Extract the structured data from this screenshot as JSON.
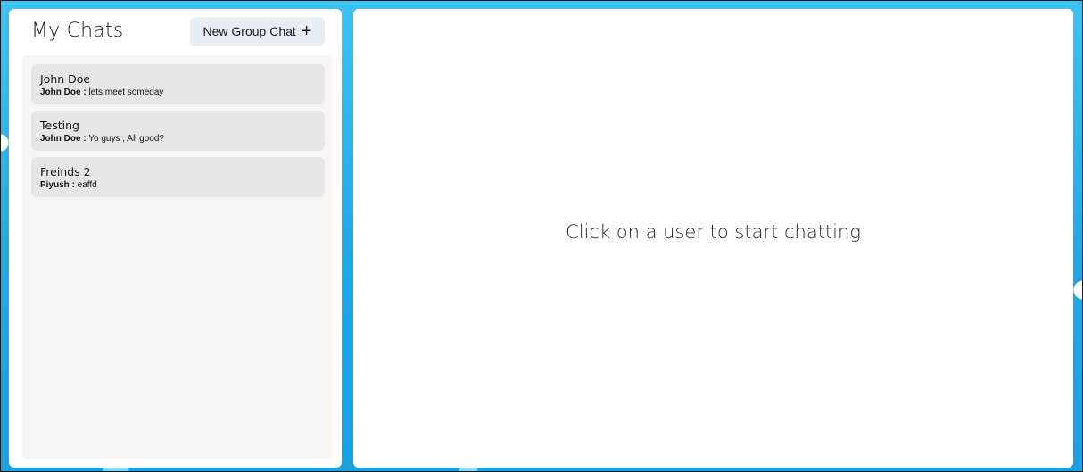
{
  "sidebar": {
    "title": "My Chats",
    "new_group_button": {
      "label": "New Group Chat",
      "icon": "plus-icon",
      "icon_glyph": "+"
    },
    "chats": [
      {
        "name": "John Doe",
        "sender": "John Doe :",
        "message": " lets meet someday"
      },
      {
        "name": "Testing",
        "sender": "John Doe :",
        "message": " Yo guys , All good?"
      },
      {
        "name": "Freinds 2",
        "sender": "Piyush :",
        "message": " eaffd"
      }
    ]
  },
  "chat_panel": {
    "placeholder": "Click on a user to start chatting"
  },
  "colors": {
    "background_accent": "#2bb4ec",
    "panel": "#ffffff",
    "chat_item": "#e6e6e6",
    "list_box": "#f6f6f6",
    "button": "#e7eef3"
  }
}
